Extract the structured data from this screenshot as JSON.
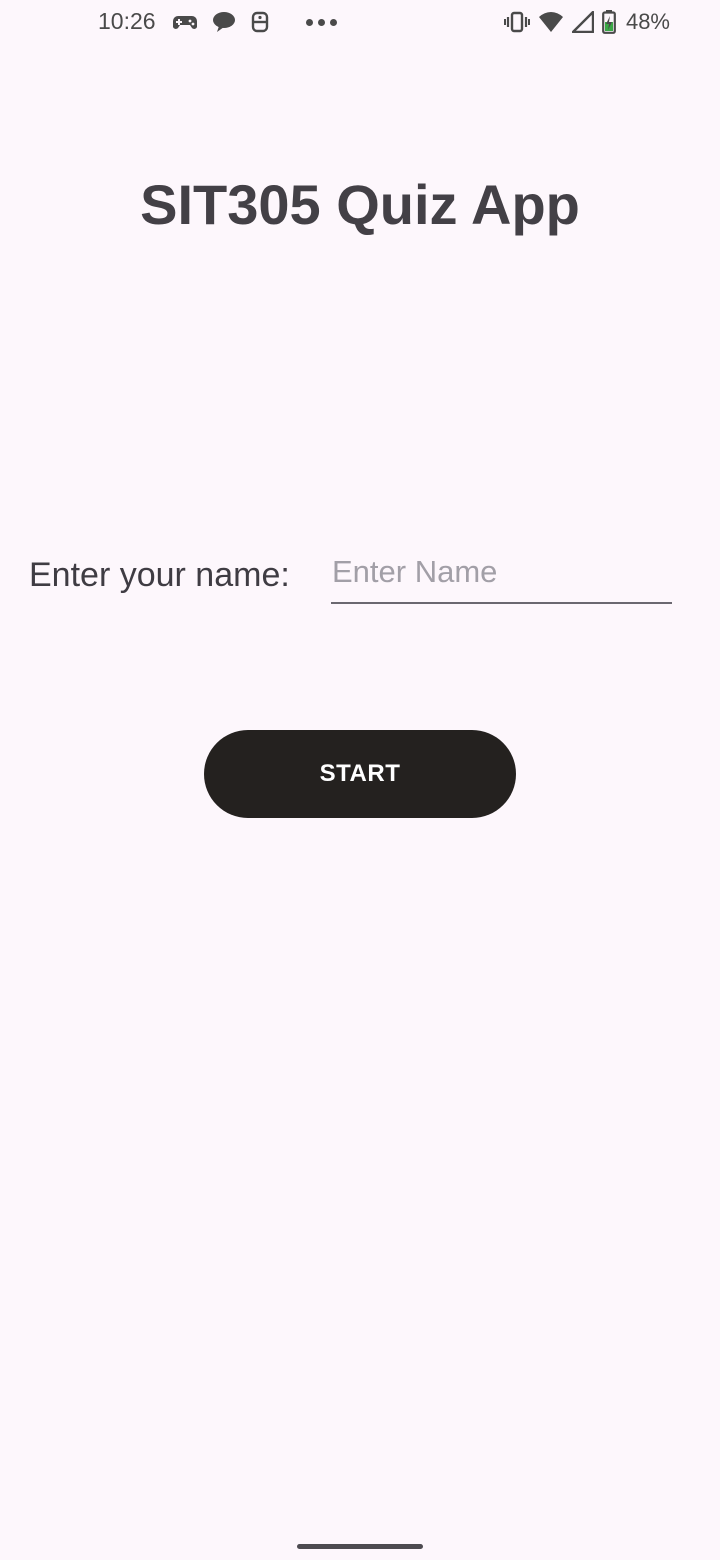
{
  "status_bar": {
    "time": "10:26",
    "notification_icons": [
      "gamepad-icon",
      "chat-bubble-icon",
      "robot-icon"
    ],
    "more_icon": "more-dots-icon",
    "system_icons": [
      "vibrate-icon",
      "wifi-icon",
      "signal-icon",
      "battery-charging-icon"
    ],
    "battery_percent": "48%"
  },
  "main": {
    "title": "SIT305 Quiz App",
    "name_label": "Enter your name:",
    "name_input": {
      "value": "",
      "placeholder": "Enter Name"
    },
    "start_button": "START"
  },
  "colors": {
    "background": "#fdf7fc",
    "button": "#24211f",
    "button_text": "#ffffff",
    "text": "#3f3c43",
    "placeholder": "#a29fa7"
  }
}
